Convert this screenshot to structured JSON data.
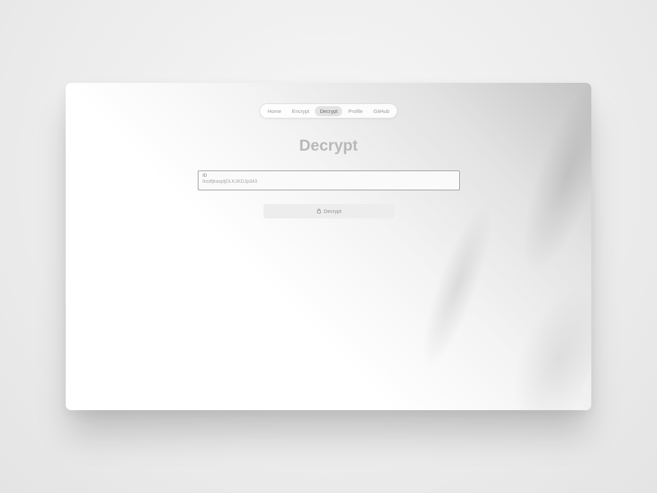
{
  "nav": {
    "items": [
      {
        "label": "Home",
        "active": false
      },
      {
        "label": "Encrypt",
        "active": false
      },
      {
        "label": "Decrypt",
        "active": true
      },
      {
        "label": "Profile",
        "active": false
      },
      {
        "label": "GitHub",
        "active": false
      }
    ]
  },
  "page": {
    "title": "Decrypt"
  },
  "form": {
    "id_label": "ID",
    "id_value": "lksdfjkasjdjDLKJKDJp343"
  },
  "action": {
    "decrypt_label": "Decrypt",
    "icon": "lock-icon"
  },
  "colors": {
    "active_pill": "#e3e3e3",
    "title_text": "#b9b9b9",
    "button_bg": "#ededed"
  }
}
